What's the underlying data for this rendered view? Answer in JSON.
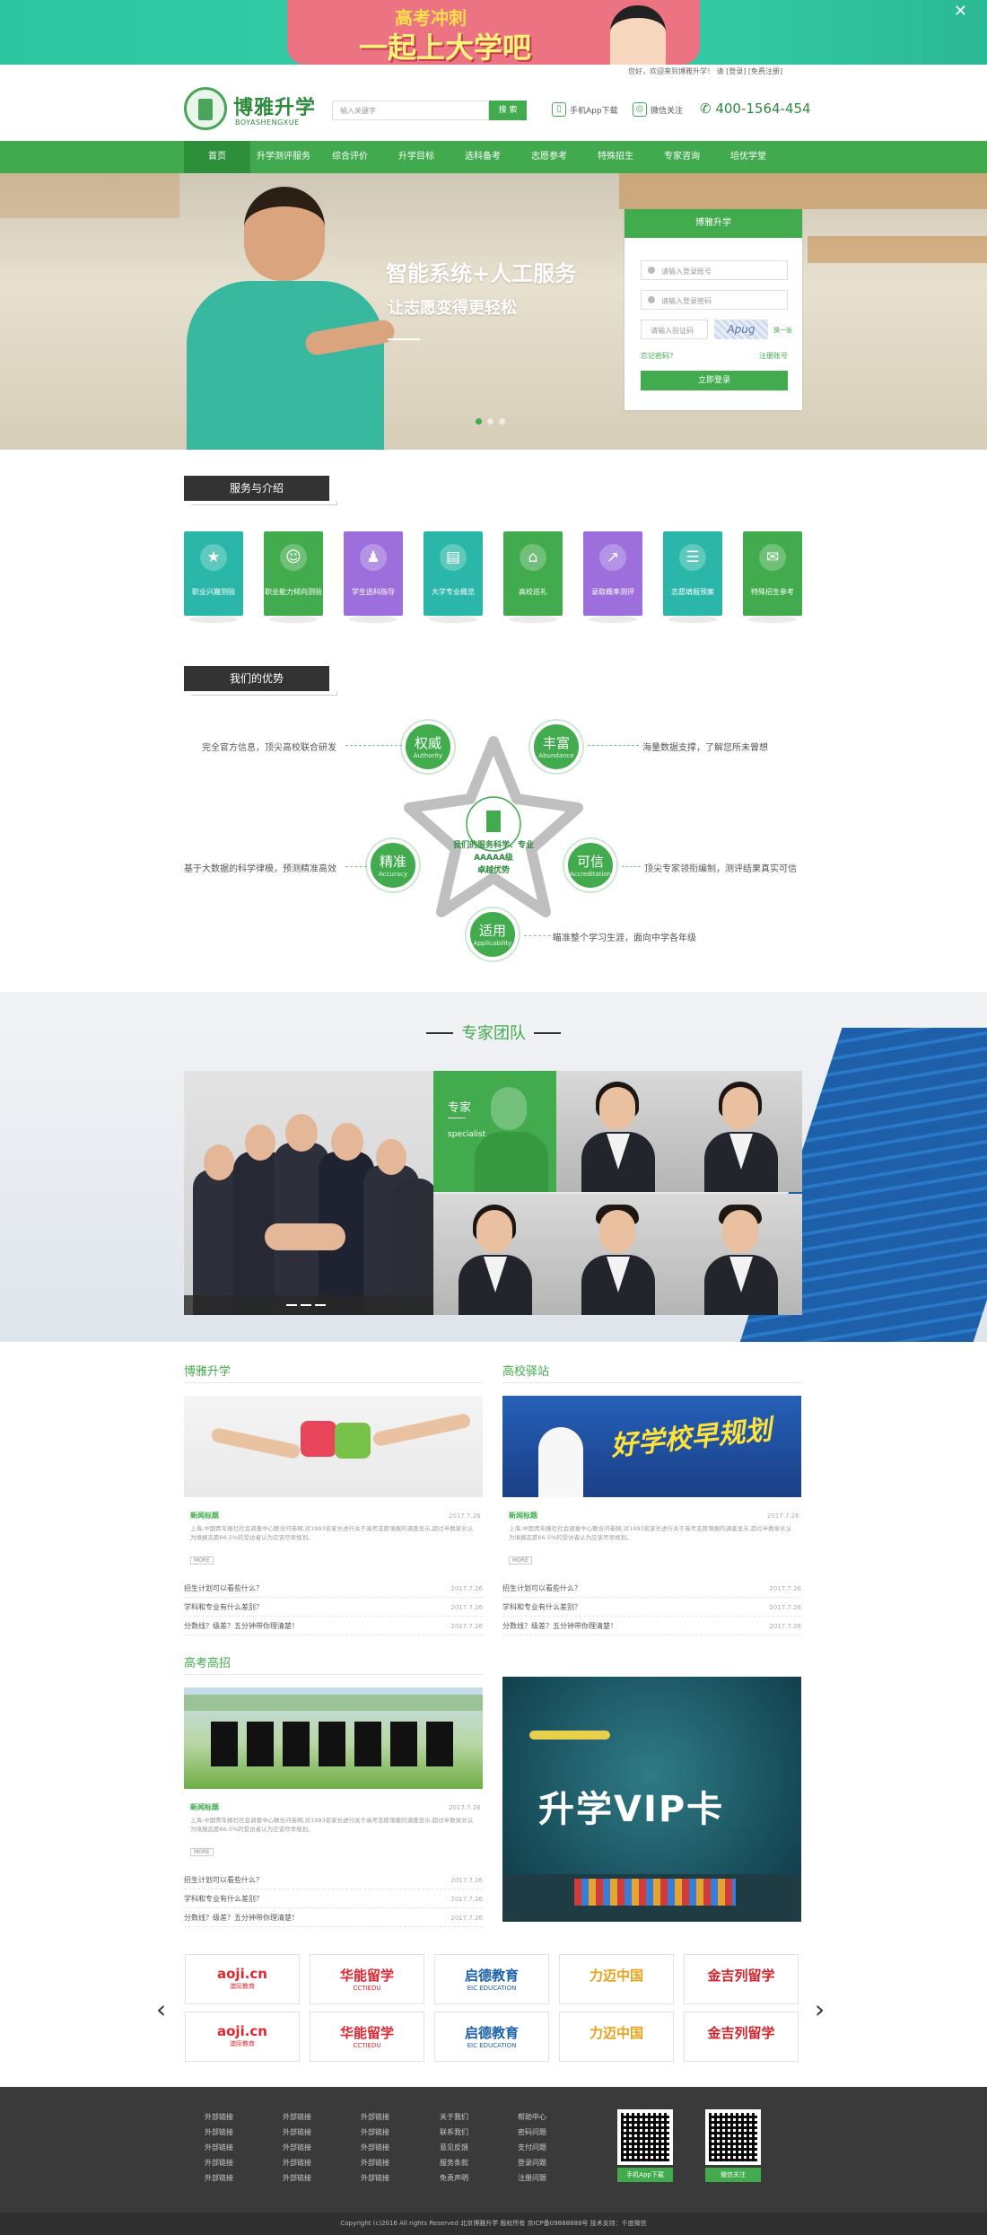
{
  "top_banner": {
    "line1": "高考冲刺",
    "line2": "一起上大学吧",
    "close": "✕",
    "icons": [
      "close-icon"
    ]
  },
  "top_info": {
    "greeting": "您好，欢迎来到博雅升学！",
    "please": "请",
    "login": "[登录]",
    "register": "[免费注册]"
  },
  "header": {
    "logo_cn": "博雅升学",
    "logo_en": "BOYASHENGXUE",
    "search_placeholder": "输入关键字",
    "search_button": "搜 索",
    "app_download": "手机App下载",
    "wechat": "微信关注",
    "phone": "400-1564-454"
  },
  "nav": {
    "items": [
      "首页",
      "升学测评服务",
      "综合评价",
      "升学目标",
      "选科备考",
      "志愿参考",
      "特殊招生",
      "专家咨询",
      "培优学堂"
    ],
    "active_index": 0
  },
  "hero": {
    "title": "智能系统+人工服务",
    "subtitle": "让志愿变得更轻松",
    "slide_count": 3,
    "active_slide": 1
  },
  "login": {
    "title": "博雅升学",
    "account_placeholder": "请输入登录账号",
    "password_placeholder": "请输入登录密码",
    "captcha_placeholder": "请输入验证码",
    "captcha_image_text": "Apug",
    "captcha_swap": "换一张",
    "forgot": "忘记密码？",
    "register": "注册账号",
    "submit": "立即登录"
  },
  "services": {
    "title": "服务与介绍",
    "items": [
      {
        "label": "职业兴趣测验",
        "color": "#2ab7a9",
        "icon": "star-icon"
      },
      {
        "label": "职业能力倾向测验",
        "color": "#41ab4d",
        "icon": "person-icon"
      },
      {
        "label": "学生选科指导",
        "color": "#9c6fdc",
        "icon": "graduate-icon"
      },
      {
        "label": "大学专业概览",
        "color": "#2ab7a9",
        "icon": "cap-icon"
      },
      {
        "label": "高校巡礼",
        "color": "#41ab4d",
        "icon": "building-icon"
      },
      {
        "label": "录取概率测评",
        "color": "#9c6fdc",
        "icon": "arrow-up-icon"
      },
      {
        "label": "志愿填报预案",
        "color": "#2ab7a9",
        "icon": "document-icon"
      },
      {
        "label": "特殊招生参考",
        "color": "#41ab4d",
        "icon": "certificate-icon"
      }
    ]
  },
  "advantages": {
    "title": "我们的优势",
    "center_line1": "我们的服务科学、专业",
    "center_line2": "AAAAA级",
    "center_line3": "卓越优势",
    "items": [
      {
        "cn": "权威",
        "en": "Authority",
        "desc": "完全官方信息，顶尖高校联合研发"
      },
      {
        "cn": "丰富",
        "en": "Abundance",
        "desc": "海量数据支撑，了解您所未曾想"
      },
      {
        "cn": "精准",
        "en": "Accuracy",
        "desc": "基于大数据的科学律模，预测精准高效"
      },
      {
        "cn": "可信",
        "en": "Accreditation",
        "desc": "顶尖专家领衔编制，测评结果真实可信"
      },
      {
        "cn": "适用",
        "en": "Applicability",
        "desc": "瞄准整个学习生涯，面向中学各年级"
      }
    ]
  },
  "experts": {
    "title": "专家团队",
    "tile_title": "专家",
    "tile_sub": "specialist"
  },
  "news_sections": [
    {
      "title": "博雅升学",
      "sub": "新闻标题",
      "date": "2017.7.26",
      "desc": "上海,中国青年报社社会调查中心联合问卷网,对1993名家长进行关于高考志愿填报的调查显示,超过半数家长认为填报志愿66.5%的受访者认为应该尽早规划。",
      "more": "MORE",
      "list": [
        {
          "t": "招生计划可以看些什么？",
          "d": "2017.7.26"
        },
        {
          "t": "学科和专业有什么差别？",
          "d": "2017.7.26"
        },
        {
          "t": "分数线？级差？五分钟带你理清楚！",
          "d": "2017.7.26"
        }
      ]
    },
    {
      "title": "高校驿站",
      "banner": "好学校早规划",
      "sub": "新闻标题",
      "date": "2017.7.26",
      "desc": "上海,中国青年报社社会调查中心联合问卷网,对1993名家长进行关于高考志愿填报的调查显示,超过半数家长认为填报志愿66.5%的受访者认为应该尽早规划。",
      "more": "MORE",
      "list": [
        {
          "t": "招生计划可以看些什么？",
          "d": "2017.7.26"
        },
        {
          "t": "学科和专业有什么差别？",
          "d": "2017.7.26"
        },
        {
          "t": "分数线？级差？五分钟带你理清楚！",
          "d": "2017.7.26"
        }
      ]
    },
    {
      "title": "高考高招",
      "sub": "新闻标题",
      "date": "2017.7.26",
      "desc": "上海,中国青年报社社会调查中心联合问卷网,对1993名家长进行关于高考志愿填报的调查显示,超过半数家长认为填报志愿66.5%的受访者认为应该尽早规划。",
      "more": "MORE",
      "list": [
        {
          "t": "招生计划可以看些什么？",
          "d": "2017.7.26"
        },
        {
          "t": "学科和专业有什么差别？",
          "d": "2017.7.26"
        },
        {
          "t": "分数线？级差？五分钟带你理清楚！",
          "d": "2017.7.26"
        }
      ]
    }
  ],
  "vip_card": {
    "text": "升学VIP卡"
  },
  "partners": [
    {
      "name": "aoji.cn",
      "sub": "澳际教育",
      "color": "#e2262f"
    },
    {
      "name": "华能留学",
      "sub": "CCTIEDU",
      "color": "#e2262f"
    },
    {
      "name": "启德教育",
      "sub": "EIC EDUCATION",
      "color": "#1c62ad"
    },
    {
      "name": "力迈中国",
      "sub": "",
      "color": "#e8a21a"
    },
    {
      "name": "金吉列留学",
      "sub": "",
      "color": "#d2242b"
    },
    {
      "name": "aoji.cn",
      "sub": "澳际教育",
      "color": "#e2262f"
    },
    {
      "name": "华能留学",
      "sub": "CCTIEDU",
      "color": "#e2262f"
    },
    {
      "name": "启德教育",
      "sub": "EIC EDUCATION",
      "color": "#1c62ad"
    },
    {
      "name": "力迈中国",
      "sub": "",
      "color": "#e8a21a"
    },
    {
      "name": "金吉列留学",
      "sub": "",
      "color": "#d2242b"
    }
  ],
  "carousel": {
    "prev": "‹",
    "next": "›"
  },
  "footer": {
    "col1": [
      "外部链接",
      "外部链接",
      "外部链接",
      "外部链接",
      "外部链接"
    ],
    "col2": [
      "外部链接",
      "外部链接",
      "外部链接",
      "外部链接",
      "外部链接"
    ],
    "col3": [
      "外部链接",
      "外部链接",
      "外部链接",
      "外部链接",
      "外部链接"
    ],
    "col4": [
      "关于我们",
      "联系我们",
      "意见反馈",
      "服务条款",
      "免责声明"
    ],
    "col5": [
      "帮助中心",
      "密码问题",
      "支付问题",
      "登录问题",
      "注册问题"
    ],
    "qr1": "手机App下载",
    "qr2": "微信关注",
    "copyright": "Copyright (c)2016 All rights Reserved    北京博雅升学    版权所有    京ICP备09888888号    技术支持：千度微信"
  }
}
